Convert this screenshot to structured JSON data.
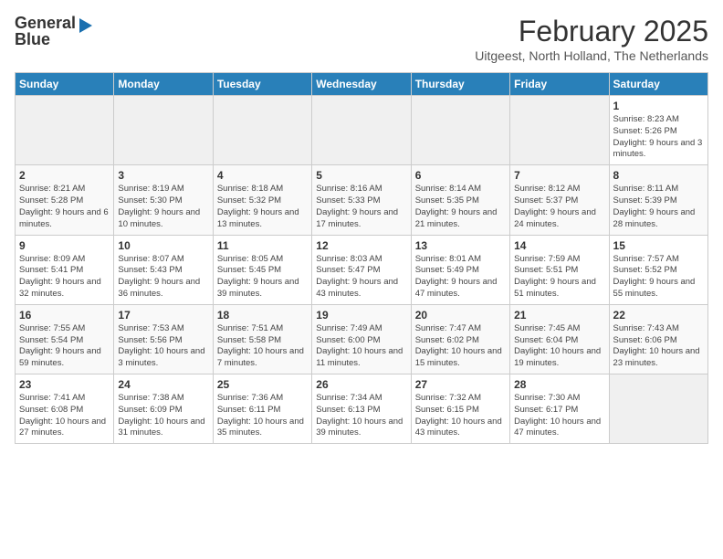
{
  "header": {
    "logo_line1": "General",
    "logo_line2": "Blue",
    "month_title": "February 2025",
    "subtitle": "Uitgeest, North Holland, The Netherlands"
  },
  "days_of_week": [
    "Sunday",
    "Monday",
    "Tuesday",
    "Wednesday",
    "Thursday",
    "Friday",
    "Saturday"
  ],
  "weeks": [
    [
      {
        "day": "",
        "info": ""
      },
      {
        "day": "",
        "info": ""
      },
      {
        "day": "",
        "info": ""
      },
      {
        "day": "",
        "info": ""
      },
      {
        "day": "",
        "info": ""
      },
      {
        "day": "",
        "info": ""
      },
      {
        "day": "1",
        "info": "Sunrise: 8:23 AM\nSunset: 5:26 PM\nDaylight: 9 hours and 3 minutes."
      }
    ],
    [
      {
        "day": "2",
        "info": "Sunrise: 8:21 AM\nSunset: 5:28 PM\nDaylight: 9 hours and 6 minutes."
      },
      {
        "day": "3",
        "info": "Sunrise: 8:19 AM\nSunset: 5:30 PM\nDaylight: 9 hours and 10 minutes."
      },
      {
        "day": "4",
        "info": "Sunrise: 8:18 AM\nSunset: 5:32 PM\nDaylight: 9 hours and 13 minutes."
      },
      {
        "day": "5",
        "info": "Sunrise: 8:16 AM\nSunset: 5:33 PM\nDaylight: 9 hours and 17 minutes."
      },
      {
        "day": "6",
        "info": "Sunrise: 8:14 AM\nSunset: 5:35 PM\nDaylight: 9 hours and 21 minutes."
      },
      {
        "day": "7",
        "info": "Sunrise: 8:12 AM\nSunset: 5:37 PM\nDaylight: 9 hours and 24 minutes."
      },
      {
        "day": "8",
        "info": "Sunrise: 8:11 AM\nSunset: 5:39 PM\nDaylight: 9 hours and 28 minutes."
      }
    ],
    [
      {
        "day": "9",
        "info": "Sunrise: 8:09 AM\nSunset: 5:41 PM\nDaylight: 9 hours and 32 minutes."
      },
      {
        "day": "10",
        "info": "Sunrise: 8:07 AM\nSunset: 5:43 PM\nDaylight: 9 hours and 36 minutes."
      },
      {
        "day": "11",
        "info": "Sunrise: 8:05 AM\nSunset: 5:45 PM\nDaylight: 9 hours and 39 minutes."
      },
      {
        "day": "12",
        "info": "Sunrise: 8:03 AM\nSunset: 5:47 PM\nDaylight: 9 hours and 43 minutes."
      },
      {
        "day": "13",
        "info": "Sunrise: 8:01 AM\nSunset: 5:49 PM\nDaylight: 9 hours and 47 minutes."
      },
      {
        "day": "14",
        "info": "Sunrise: 7:59 AM\nSunset: 5:51 PM\nDaylight: 9 hours and 51 minutes."
      },
      {
        "day": "15",
        "info": "Sunrise: 7:57 AM\nSunset: 5:52 PM\nDaylight: 9 hours and 55 minutes."
      }
    ],
    [
      {
        "day": "16",
        "info": "Sunrise: 7:55 AM\nSunset: 5:54 PM\nDaylight: 9 hours and 59 minutes."
      },
      {
        "day": "17",
        "info": "Sunrise: 7:53 AM\nSunset: 5:56 PM\nDaylight: 10 hours and 3 minutes."
      },
      {
        "day": "18",
        "info": "Sunrise: 7:51 AM\nSunset: 5:58 PM\nDaylight: 10 hours and 7 minutes."
      },
      {
        "day": "19",
        "info": "Sunrise: 7:49 AM\nSunset: 6:00 PM\nDaylight: 10 hours and 11 minutes."
      },
      {
        "day": "20",
        "info": "Sunrise: 7:47 AM\nSunset: 6:02 PM\nDaylight: 10 hours and 15 minutes."
      },
      {
        "day": "21",
        "info": "Sunrise: 7:45 AM\nSunset: 6:04 PM\nDaylight: 10 hours and 19 minutes."
      },
      {
        "day": "22",
        "info": "Sunrise: 7:43 AM\nSunset: 6:06 PM\nDaylight: 10 hours and 23 minutes."
      }
    ],
    [
      {
        "day": "23",
        "info": "Sunrise: 7:41 AM\nSunset: 6:08 PM\nDaylight: 10 hours and 27 minutes."
      },
      {
        "day": "24",
        "info": "Sunrise: 7:38 AM\nSunset: 6:09 PM\nDaylight: 10 hours and 31 minutes."
      },
      {
        "day": "25",
        "info": "Sunrise: 7:36 AM\nSunset: 6:11 PM\nDaylight: 10 hours and 35 minutes."
      },
      {
        "day": "26",
        "info": "Sunrise: 7:34 AM\nSunset: 6:13 PM\nDaylight: 10 hours and 39 minutes."
      },
      {
        "day": "27",
        "info": "Sunrise: 7:32 AM\nSunset: 6:15 PM\nDaylight: 10 hours and 43 minutes."
      },
      {
        "day": "28",
        "info": "Sunrise: 7:30 AM\nSunset: 6:17 PM\nDaylight: 10 hours and 47 minutes."
      },
      {
        "day": "",
        "info": ""
      }
    ]
  ]
}
